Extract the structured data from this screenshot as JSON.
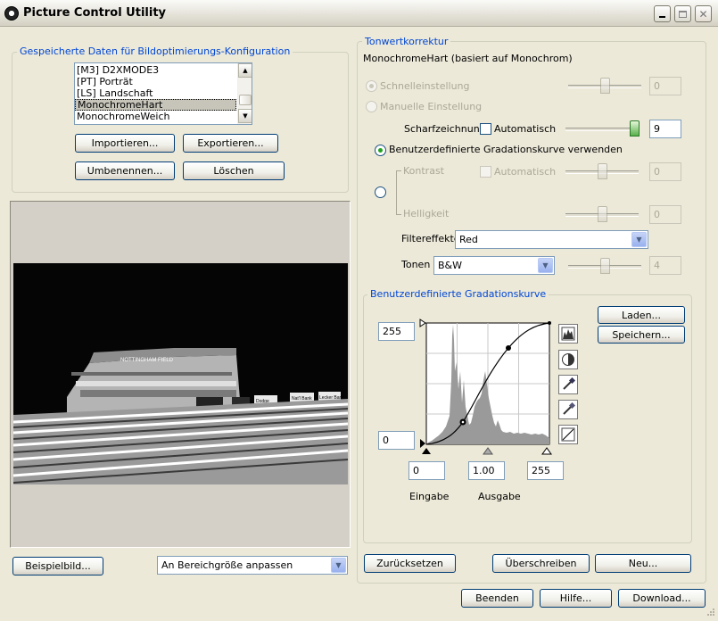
{
  "window": {
    "title": "Picture Control Utility"
  },
  "saved": {
    "group_title": "Gespeicherte Daten für Bildoptimierungs-Konfiguration",
    "items": [
      "[M3] D2XMODE3",
      "[PT] Porträt",
      "[LS] Landschaft",
      "MonochromeHart",
      "MonochromeWeich"
    ],
    "selected_index": 3,
    "import_label": "Importieren...",
    "export_label": "Exportieren...",
    "rename_label": "Umbenennen...",
    "delete_label": "Löschen"
  },
  "preview": {
    "sample_label": "Beispielbild...",
    "fit_value": "An Bereichgröße anpassen",
    "sign_top": "NOTTINGHAM FIELD",
    "sign_a": "Dodge",
    "sign_b": "Nat'l Bank",
    "sign_c": "Lecker Bank"
  },
  "tone": {
    "group_title": "Tonwertkorrektur",
    "base_text": "MonochromeHart (basiert auf Monochrom)",
    "quick_label": "Schnelleinstellung",
    "quick_value": "0",
    "manual_label": "Manuelle Einstellung",
    "sharpen_label": "Scharfzeichnung",
    "auto_label": "Automatisch",
    "sharpen_value": "9",
    "custom_curve_label": "Benutzerdefinierte Gradationskurve verwenden",
    "contrast_label": "Kontrast",
    "contrast_auto_label": "Automatisch",
    "contrast_value": "0",
    "brightness_label": "Helligkeit",
    "brightness_value": "0",
    "filter_label": "Filtereffekte",
    "filter_value": "Red",
    "toning_label": "Tonen",
    "toning_value": "B&W",
    "toning_amount": "4"
  },
  "curve": {
    "group_title": "Benutzerdefinierte Gradationskurve",
    "output_max": "255",
    "output_min": "0",
    "input_min": "0",
    "gamma": "1.00",
    "input_max": "255",
    "input_label": "Eingabe",
    "output_label": "Ausgabe",
    "load_label": "Laden...",
    "save_label": "Speichern..."
  },
  "actions": {
    "reset_label": "Zurücksetzen",
    "overwrite_label": "Überschreiben",
    "new_label": "Neu...",
    "quit_label": "Beenden",
    "help_label": "Hilfe...",
    "download_label": "Download..."
  }
}
